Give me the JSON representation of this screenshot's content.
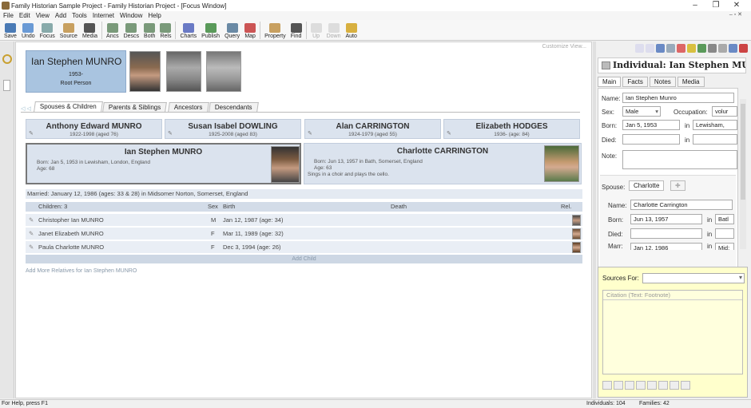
{
  "window": {
    "title": "Family Historian Sample Project - Family Historian Project - [Focus Window]"
  },
  "menu": {
    "items": [
      "File",
      "Edit",
      "View",
      "Add",
      "Tools",
      "Internet",
      "Window",
      "Help"
    ]
  },
  "toolbar": {
    "buttons": [
      "Save",
      "Undo",
      "Focus",
      "Source",
      "Media",
      "Ancs",
      "Descs",
      "Both",
      "Rels",
      "Charts",
      "Publish",
      "Query",
      "Map",
      "Property",
      "Find",
      "Up",
      "Down",
      "Auto"
    ]
  },
  "focus": {
    "customize": "Customize View...",
    "root": {
      "name": "Ian Stephen MUNRO",
      "years": "1953-",
      "role": "Root Person"
    },
    "tabs": [
      "Spouses & Children",
      "Parents & Siblings",
      "Ancestors",
      "Descendants"
    ],
    "parents": [
      {
        "name": "Anthony Edward MUNRO",
        "dates": "1922-1998 (aged 76)"
      },
      {
        "name": "Susan Isabel DOWLING",
        "dates": "1925-2008 (aged 83)"
      },
      {
        "name": "Alan CARRINGTON",
        "dates": "1924-1979 (aged 55)"
      },
      {
        "name": "Elizabeth HODGES",
        "dates": "1936- (age: 84)"
      }
    ],
    "couple": [
      {
        "name": "Ian Stephen MUNRO",
        "born": "Born:  Jan 5, 1953 in Lewisham, London, England",
        "age": "Age:   68",
        "note": ""
      },
      {
        "name": "Charlotte CARRINGTON",
        "born": "Born:  Jun 13, 1957 in Bath, Somerset, England",
        "age": "Age:   63",
        "note": "Sings in a choir and plays the cello."
      }
    ],
    "married": "Married: January 12, 1986 (ages: 33 & 28) in Midsomer Norton, Somerset, England",
    "children_header": {
      "children": "Children: 3",
      "sex": "Sex",
      "birth": "Birth",
      "death": "Death",
      "rel": "Rel."
    },
    "children": [
      {
        "name": "Christopher Ian MUNRO",
        "sex": "M",
        "birth": "Jan 12, 1987 (age: 34)",
        "death": ""
      },
      {
        "name": "Janet Elizabeth MUNRO",
        "sex": "F",
        "birth": "Mar 11, 1989 (age: 32)",
        "death": ""
      },
      {
        "name": "Paula Charlotte MUNRO",
        "sex": "F",
        "birth": "Dec 3, 1994 (age: 26)",
        "death": ""
      }
    ],
    "add_child": "Add Child",
    "add_more": "Add More Relatives for Ian Stephen MUNRO"
  },
  "property": {
    "header": "Individual: Ian Stephen MUNR...",
    "tabs": [
      "Main",
      "Facts",
      "Notes",
      "Media"
    ],
    "name_label": "Name:",
    "name_value": "Ian Stephen Munro",
    "sex_label": "Sex:",
    "sex_value": "Male",
    "occupation_label": "Occupation:",
    "occupation_value": "volur",
    "born_label": "Born:",
    "born_value": "Jan 5, 1953",
    "in_label": "in",
    "born_place": "Lewisham,",
    "died_label": "Died:",
    "note_label": "Note:",
    "spouse_label": "Spouse:",
    "spouse_tab": "Charlotte",
    "sp_name_label": "Name:",
    "sp_name_value": "Charlotte Carrington",
    "sp_born_label": "Born:",
    "sp_born_value": "Jun 13, 1957",
    "sp_born_place": "Batl",
    "sp_died_label": "Died:",
    "sp_marr_label": "Marr:",
    "sp_marr_value": "Jan 12, 1986",
    "sp_marr_place": "Mid:"
  },
  "sources": {
    "label": "Sources For:",
    "citation": "Citation (Text: Footnote)"
  },
  "status": {
    "help": "For Help, press F1",
    "individuals": "Individuals: 104",
    "families": "Families: 42"
  },
  "colors": {
    "root_box": "#a9c4e0",
    "person_box": "#dbe3ee",
    "sources_bg": "#ffffcc"
  }
}
